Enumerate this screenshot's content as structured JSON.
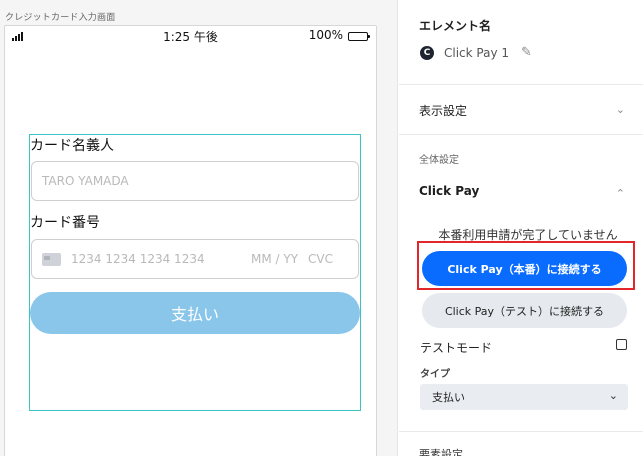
{
  "canvas": {
    "screen_title": "クレジットカード入力画面",
    "status_bar": {
      "time": "1:25 午後",
      "battery": "100%"
    },
    "form": {
      "cardholder_label": "カード名義人",
      "cardholder_placeholder": "TARO YAMADA",
      "card_number_label": "カード番号",
      "card_number_placeholder": "1234 1234 1234 1234",
      "expiry_placeholder": "MM / YY",
      "cvc_placeholder": "CVC",
      "pay_button": "支払い"
    }
  },
  "panel": {
    "element_name_title": "エレメント名",
    "element_name": "Click Pay 1",
    "display_settings": "表示設定",
    "global_settings": "全体設定",
    "click_pay_title": "Click Pay",
    "notice": "本番利用申請が完了していません",
    "connect_live_button": "Click Pay（本番）に接続する",
    "connect_test_button": "Click Pay（テスト）に接続する",
    "test_mode_label": "テストモード",
    "test_mode_checked": false,
    "type_label": "タイプ",
    "type_value": "支払い",
    "next_section": "要素設定"
  },
  "colors": {
    "primary": "#0A6CFF",
    "highlight": "#E2262A",
    "pay_button": "#89C6EA",
    "form_border": "#3CC4C4"
  },
  "icons": {
    "element": "click-pay-logo-icon",
    "edit": "pencil-icon",
    "chevron_down": "chevron-down-icon",
    "chevron_up": "chevron-up-icon",
    "card": "credit-card-icon"
  }
}
